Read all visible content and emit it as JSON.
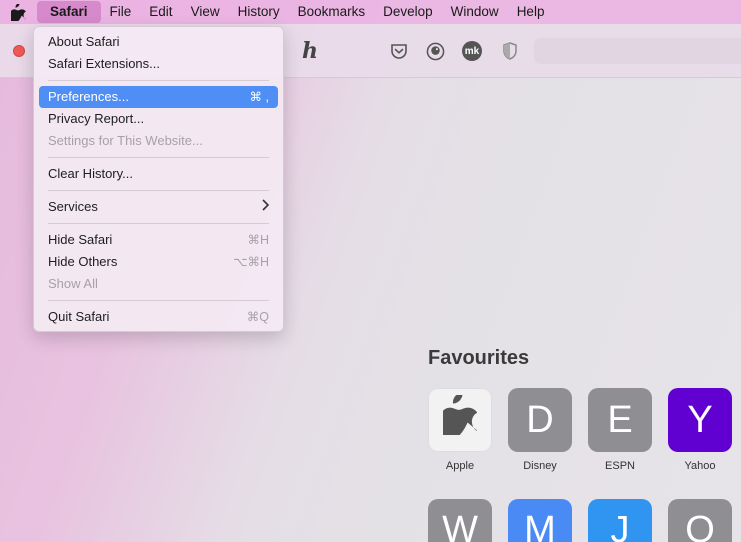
{
  "menubar": {
    "items": [
      "Safari",
      "File",
      "Edit",
      "View",
      "History",
      "Bookmarks",
      "Develop",
      "Window",
      "Help"
    ]
  },
  "dropdown": {
    "about": "About Safari",
    "extensions": "Safari Extensions...",
    "preferences": {
      "label": "Preferences...",
      "shortcut": "⌘ ,"
    },
    "privacy": "Privacy Report...",
    "settings_site": "Settings for This Website...",
    "clear_history": "Clear History...",
    "services": "Services",
    "hide_safari": {
      "label": "Hide Safari",
      "shortcut": "⌘H"
    },
    "hide_others": {
      "label": "Hide Others",
      "shortcut": "⌥⌘H"
    },
    "show_all": "Show All",
    "quit": {
      "label": "Quit Safari",
      "shortcut": "⌘Q"
    }
  },
  "toolbar": {
    "icons": [
      "honey-h-icon",
      "pocket-icon",
      "duckduckgo-icon",
      "mk-extension-icon",
      "privacy-shield-icon"
    ],
    "mk_text": "mk",
    "honey_text": "h"
  },
  "favourites": {
    "title": "Favourites",
    "tiles": [
      {
        "letter": "",
        "label": "Apple",
        "color": "#f2f2f2",
        "icon": "apple-icon"
      },
      {
        "letter": "D",
        "label": "Disney",
        "color": "#8e8e93"
      },
      {
        "letter": "E",
        "label": "ESPN",
        "color": "#8e8e93"
      },
      {
        "letter": "Y",
        "label": "Yahoo",
        "color": "#6001d2"
      }
    ],
    "row2": [
      {
        "letter": "W",
        "color": "#8e8e93"
      },
      {
        "letter": "M",
        "color": "#4a8af4"
      },
      {
        "letter": "J",
        "color": "#2f95f0"
      },
      {
        "letter": "O",
        "color": "#8e8e93"
      }
    ]
  }
}
